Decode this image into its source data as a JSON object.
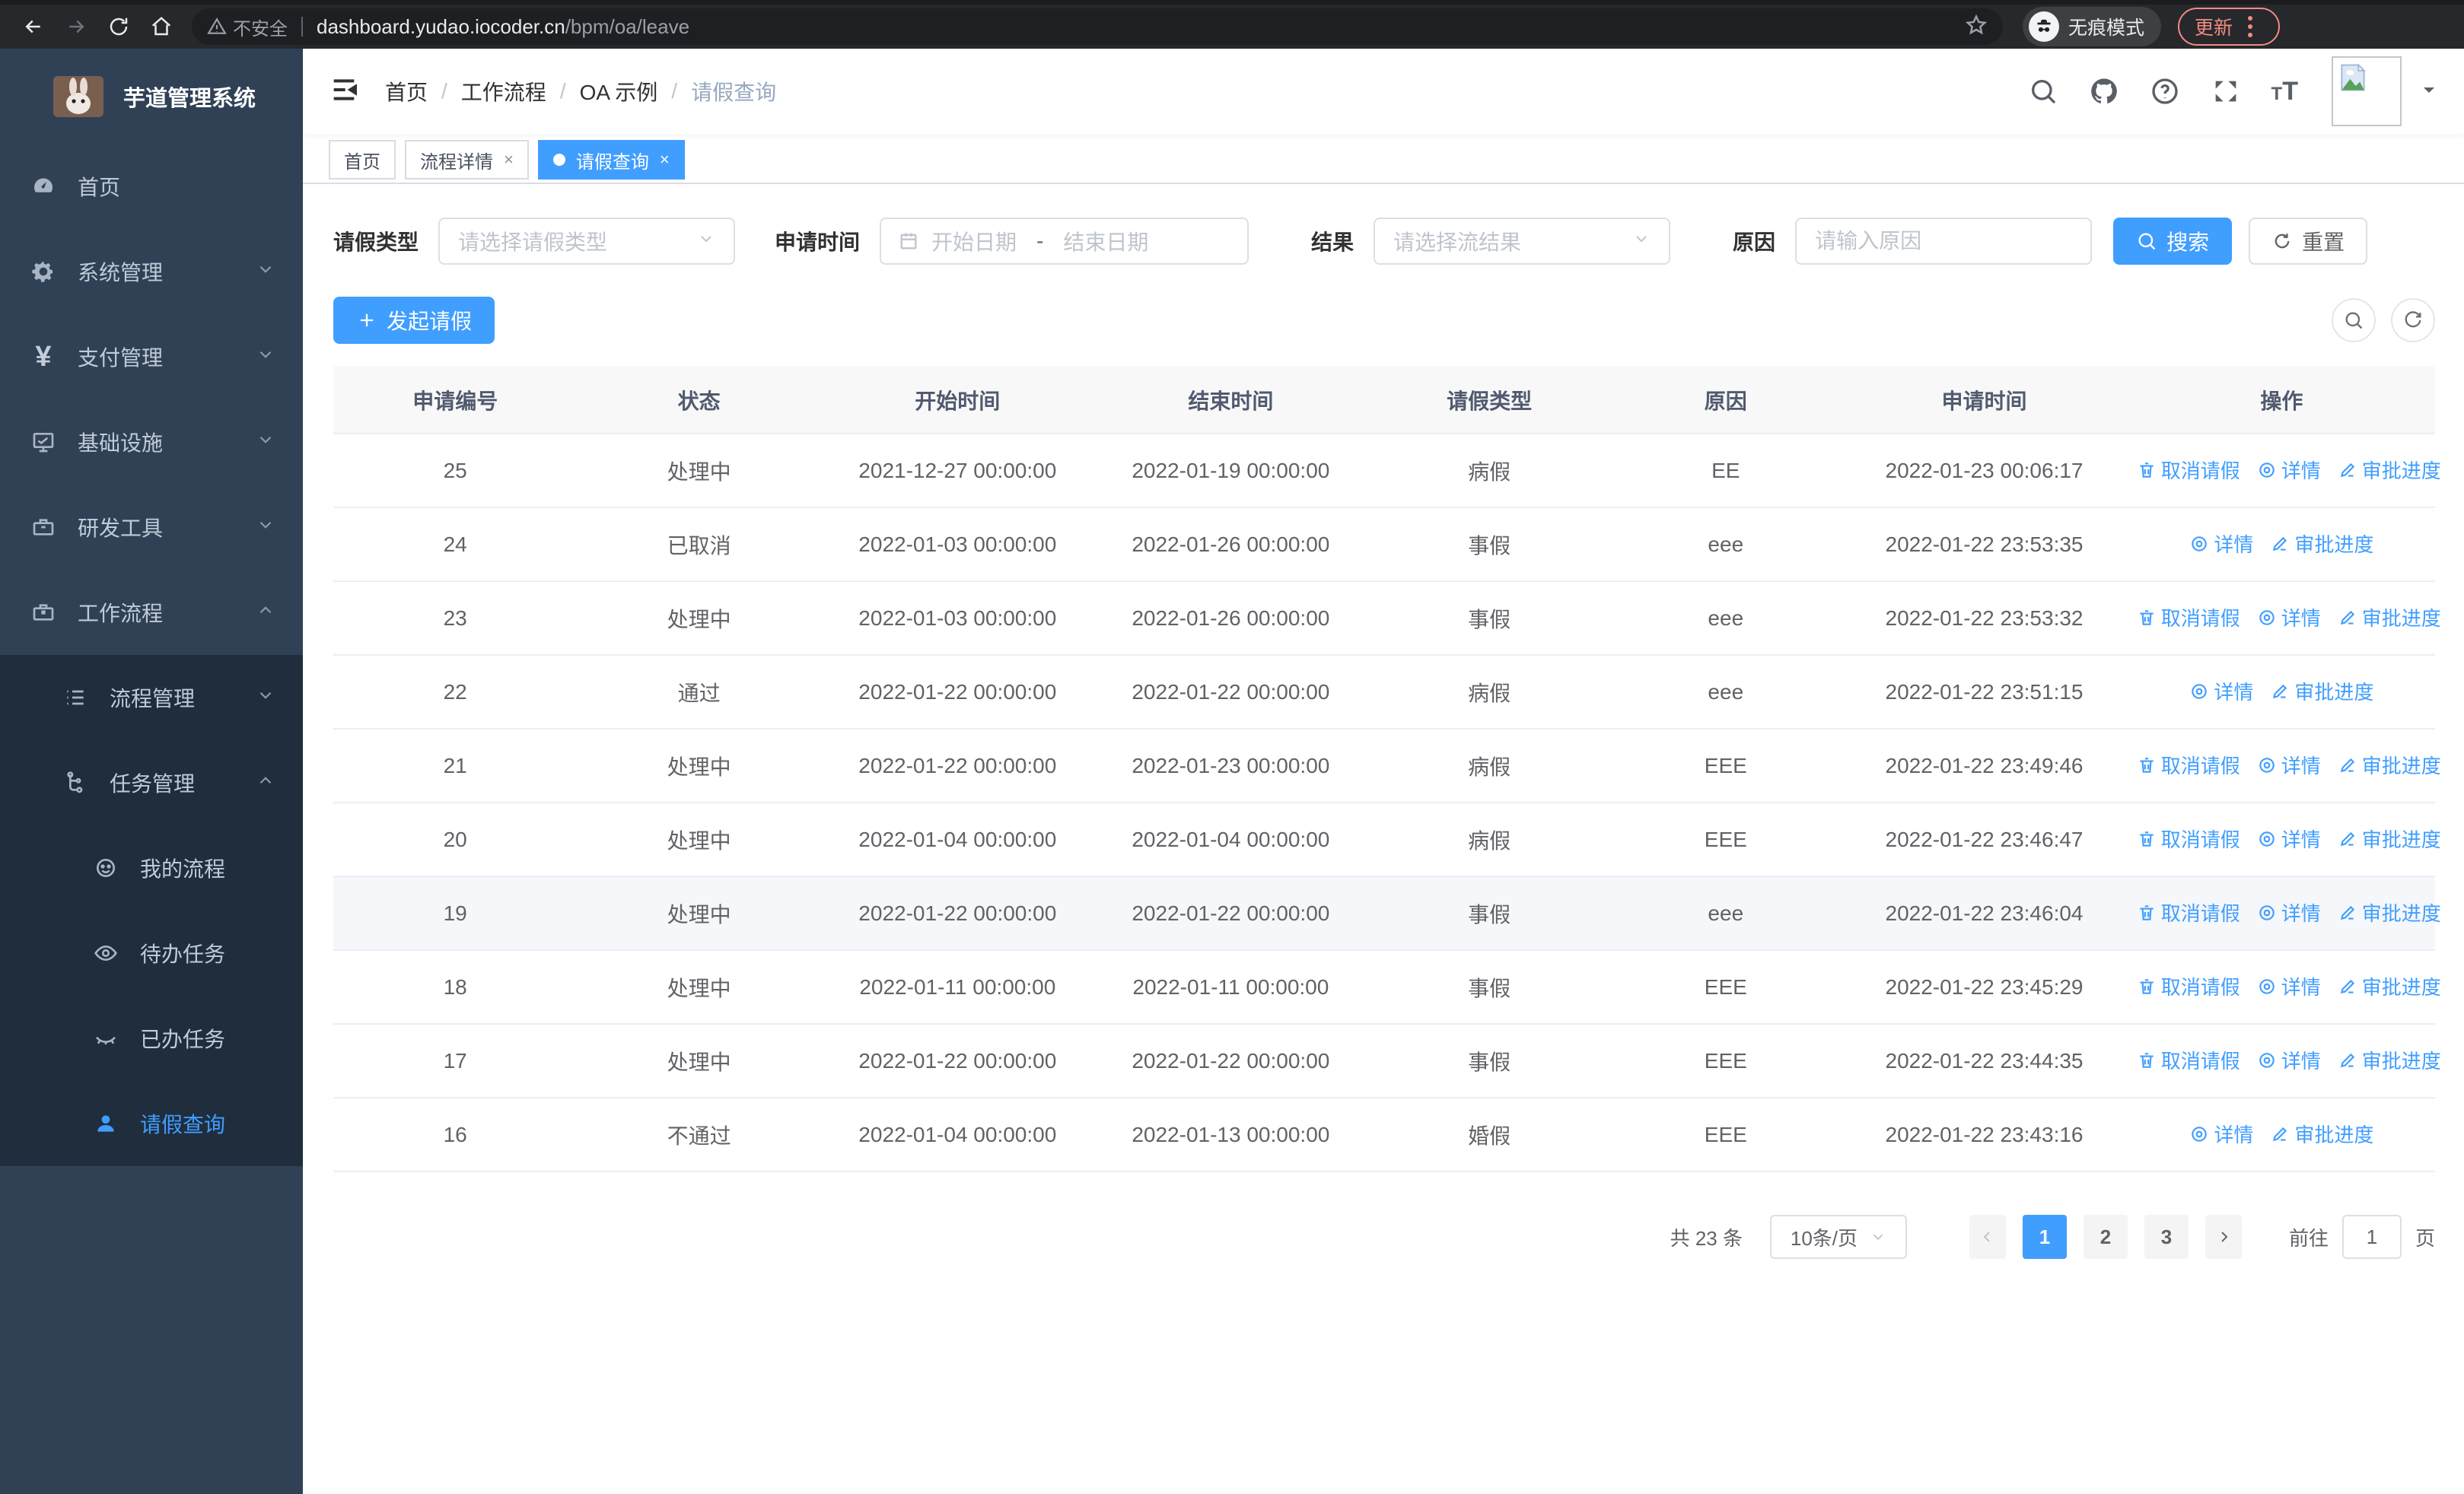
{
  "browser": {
    "security_label": "不安全",
    "url_host": "dashboard.yudao.iocoder.cn",
    "url_path": "/bpm/oa/leave",
    "incognito_label": "无痕模式",
    "update_label": "更新"
  },
  "sidebar": {
    "title": "芋道管理系统",
    "items": [
      {
        "label": "首页",
        "icon": "gauge-icon"
      },
      {
        "label": "系统管理",
        "icon": "gear-icon"
      },
      {
        "label": "支付管理",
        "icon": "yen-icon"
      },
      {
        "label": "基础设施",
        "icon": "monitor-icon"
      },
      {
        "label": "研发工具",
        "icon": "toolbox-icon"
      },
      {
        "label": "工作流程",
        "icon": "briefcase-icon"
      }
    ],
    "submenu": [
      {
        "label": "流程管理",
        "icon": "list-icon"
      },
      {
        "label": "任务管理",
        "icon": "flow-icon"
      },
      {
        "label": "我的流程",
        "icon": "face-icon"
      },
      {
        "label": "待办任务",
        "icon": "eye-icon"
      },
      {
        "label": "已办任务",
        "icon": "eye-closed-icon"
      },
      {
        "label": "请假查询",
        "icon": "user-icon"
      }
    ]
  },
  "breadcrumb": {
    "items": [
      "首页",
      "工作流程",
      "OA 示例",
      "请假查询"
    ],
    "separator": "/"
  },
  "tabs": [
    {
      "label": "首页"
    },
    {
      "label": "流程详情",
      "close": "×"
    },
    {
      "label": "请假查询",
      "close": "×"
    }
  ],
  "filters": {
    "leave_type_label": "请假类型",
    "leave_type_placeholder": "请选择请假类型",
    "apply_time_label": "申请时间",
    "start_date_placeholder": "开始日期",
    "range_separator": "-",
    "end_date_placeholder": "结束日期",
    "result_label": "结果",
    "result_placeholder": "请选择流结果",
    "reason_label": "原因",
    "reason_placeholder": "请输入原因",
    "search_label": "搜索",
    "reset_label": "重置"
  },
  "toolbar": {
    "create_label": "发起请假"
  },
  "table": {
    "headers": [
      "申请编号",
      "状态",
      "开始时间",
      "结束时间",
      "请假类型",
      "原因",
      "申请时间",
      "操作"
    ],
    "action_labels": {
      "cancel": "取消请假",
      "detail": "详情",
      "progress": "审批进度"
    },
    "rows": [
      {
        "id": "25",
        "status": "处理中",
        "start": "2021-12-27 00:00:00",
        "end": "2022-01-19 00:00:00",
        "type": "病假",
        "reason": "EE",
        "applied": "2022-01-23 00:06:17",
        "actions": [
          "cancel",
          "detail",
          "progress"
        ]
      },
      {
        "id": "24",
        "status": "已取消",
        "start": "2022-01-03 00:00:00",
        "end": "2022-01-26 00:00:00",
        "type": "事假",
        "reason": "eee",
        "applied": "2022-01-22 23:53:35",
        "actions": [
          "detail",
          "progress"
        ]
      },
      {
        "id": "23",
        "status": "处理中",
        "start": "2022-01-03 00:00:00",
        "end": "2022-01-26 00:00:00",
        "type": "事假",
        "reason": "eee",
        "applied": "2022-01-22 23:53:32",
        "actions": [
          "cancel",
          "detail",
          "progress"
        ]
      },
      {
        "id": "22",
        "status": "通过",
        "start": "2022-01-22 00:00:00",
        "end": "2022-01-22 00:00:00",
        "type": "病假",
        "reason": "eee",
        "applied": "2022-01-22 23:51:15",
        "actions": [
          "detail",
          "progress"
        ]
      },
      {
        "id": "21",
        "status": "处理中",
        "start": "2022-01-22 00:00:00",
        "end": "2022-01-23 00:00:00",
        "type": "病假",
        "reason": "EEE",
        "applied": "2022-01-22 23:49:46",
        "actions": [
          "cancel",
          "detail",
          "progress"
        ]
      },
      {
        "id": "20",
        "status": "处理中",
        "start": "2022-01-04 00:00:00",
        "end": "2022-01-04 00:00:00",
        "type": "病假",
        "reason": "EEE",
        "applied": "2022-01-22 23:46:47",
        "actions": [
          "cancel",
          "detail",
          "progress"
        ]
      },
      {
        "id": "19",
        "status": "处理中",
        "start": "2022-01-22 00:00:00",
        "end": "2022-01-22 00:00:00",
        "type": "事假",
        "reason": "eee",
        "applied": "2022-01-22 23:46:04",
        "actions": [
          "cancel",
          "detail",
          "progress"
        ],
        "highlighted": true
      },
      {
        "id": "18",
        "status": "处理中",
        "start": "2022-01-11 00:00:00",
        "end": "2022-01-11 00:00:00",
        "type": "事假",
        "reason": "EEE",
        "applied": "2022-01-22 23:45:29",
        "actions": [
          "cancel",
          "detail",
          "progress"
        ]
      },
      {
        "id": "17",
        "status": "处理中",
        "start": "2022-01-22 00:00:00",
        "end": "2022-01-22 00:00:00",
        "type": "事假",
        "reason": "EEE",
        "applied": "2022-01-22 23:44:35",
        "actions": [
          "cancel",
          "detail",
          "progress"
        ]
      },
      {
        "id": "16",
        "status": "不通过",
        "start": "2022-01-04 00:00:00",
        "end": "2022-01-13 00:00:00",
        "type": "婚假",
        "reason": "EEE",
        "applied": "2022-01-22 23:43:16",
        "actions": [
          "detail",
          "progress"
        ]
      }
    ]
  },
  "pagination": {
    "total_label": "共 23 条",
    "page_size": "10条/页",
    "pages": [
      "1",
      "2",
      "3"
    ],
    "active_page": "1",
    "goto_label": "前往",
    "goto_value": "1",
    "page_unit": "页"
  },
  "colors": {
    "primary": "#409eff",
    "sidebar_bg": "#304156",
    "submenu_bg": "#1f2d3d",
    "update_red": "#f28b82"
  }
}
